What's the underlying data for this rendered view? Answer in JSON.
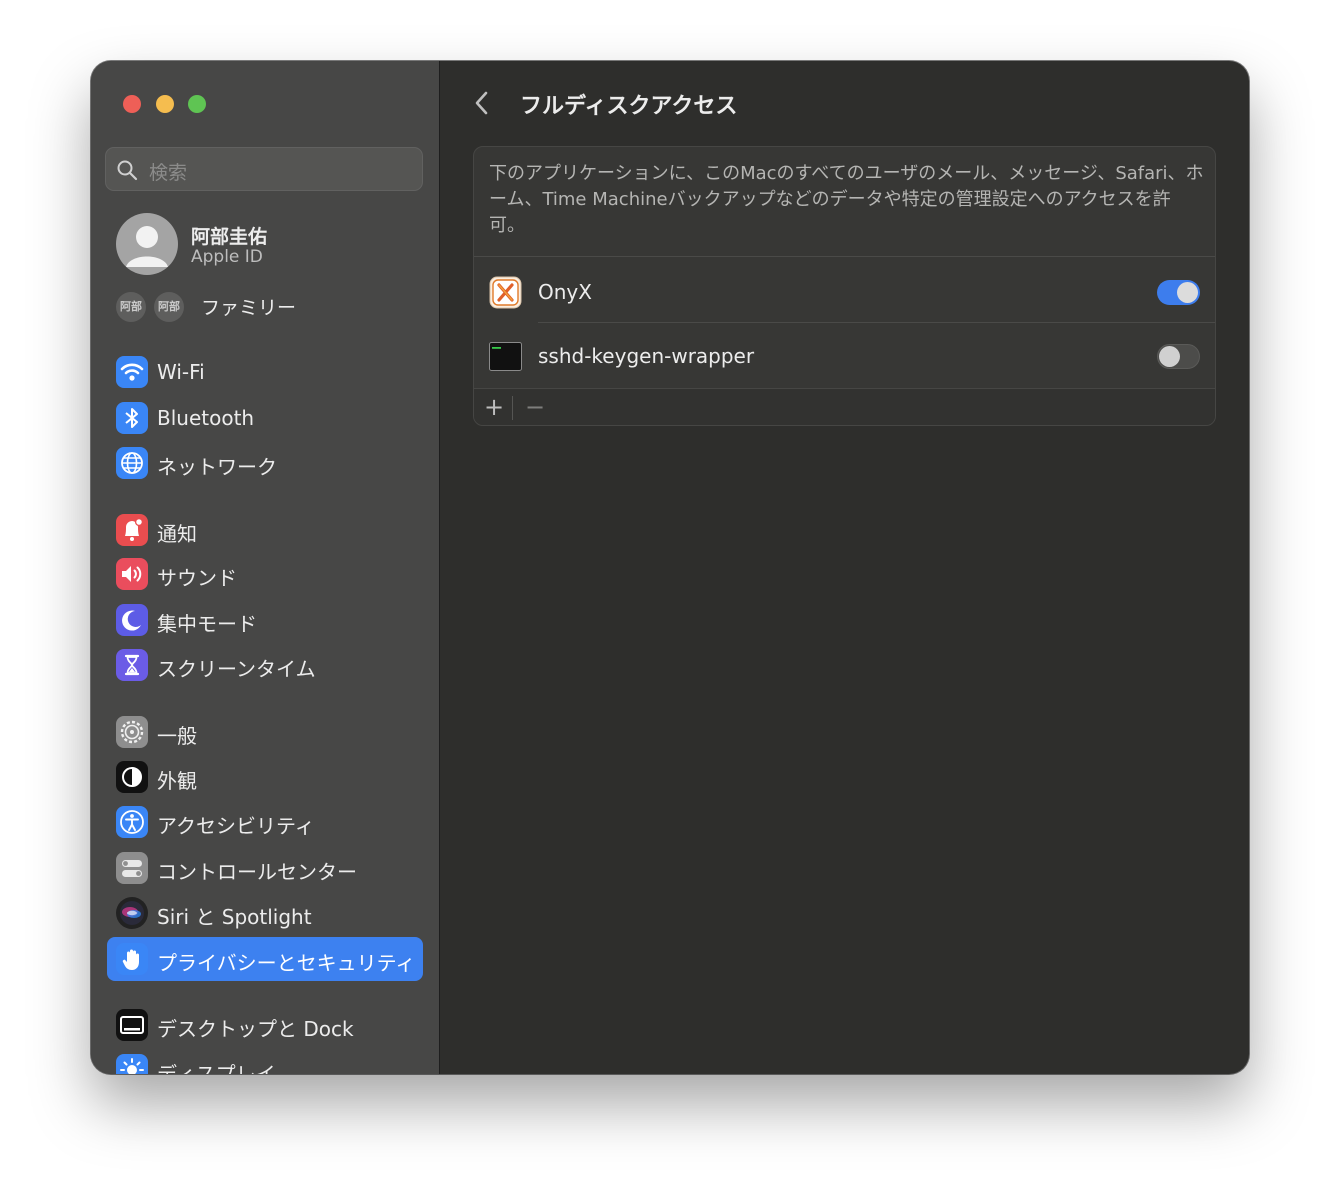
{
  "window": {
    "traffic_lights": [
      "close",
      "minimize",
      "zoom"
    ]
  },
  "sidebar": {
    "search_placeholder": "検索",
    "profile": {
      "name": "阿部圭佑",
      "subtitle": "Apple ID"
    },
    "family": {
      "members": [
        "阿部",
        "阿部"
      ],
      "label": "ファミリー"
    },
    "items": [
      {
        "label": "Wi-Fi",
        "icon": "wifi-icon",
        "color": "#3a86f6"
      },
      {
        "label": "Bluetooth",
        "icon": "bluetooth-icon",
        "color": "#3a86f6"
      },
      {
        "label": "ネットワーク",
        "icon": "globe-icon",
        "color": "#3a86f6"
      },
      {
        "label": "通知",
        "icon": "bell-icon",
        "color": "#ea4d4f"
      },
      {
        "label": "サウンド",
        "icon": "speaker-icon",
        "color": "#ea4d5d"
      },
      {
        "label": "集中モード",
        "icon": "moon-icon",
        "color": "#5d5ce6"
      },
      {
        "label": "スクリーンタイム",
        "icon": "hourglass-icon",
        "color": "#6b5ce6"
      },
      {
        "label": "一般",
        "icon": "gear-icon",
        "color": "#8e8e8e"
      },
      {
        "label": "外観",
        "icon": "appearance-icon",
        "color": "#111111"
      },
      {
        "label": "アクセシビリティ",
        "icon": "accessibility-icon",
        "color": "#3a86f6"
      },
      {
        "label": "コントロールセンター",
        "icon": "control-center-icon",
        "color": "#8e8e8e"
      },
      {
        "label": "Siri と Spotlight",
        "icon": "siri-icon",
        "color": "#222222"
      },
      {
        "label": "プライバシーとセキュリティ",
        "icon": "hand-icon",
        "color": "#3a86f6",
        "active": true
      },
      {
        "label": "デスクトップと Dock",
        "icon": "dock-icon",
        "color": "#111111"
      },
      {
        "label": "ディスプレイ",
        "icon": "display-icon",
        "color": "#3a86f6"
      }
    ]
  },
  "main": {
    "title": "フルディスクアクセス",
    "description": "下のアプリケーションに、このMacのすべてのユーザのメール、メッセージ、Safari、ホーム、Time Machineバックアップなどのデータや特定の管理設定へのアクセスを許可。",
    "apps": [
      {
        "name": "OnyX",
        "icon": "onyx-app-icon",
        "enabled": true
      },
      {
        "name": "sshd-keygen-wrapper",
        "icon": "terminal-exec-icon",
        "enabled": false
      }
    ],
    "add_label": "+",
    "remove_label": "−"
  }
}
